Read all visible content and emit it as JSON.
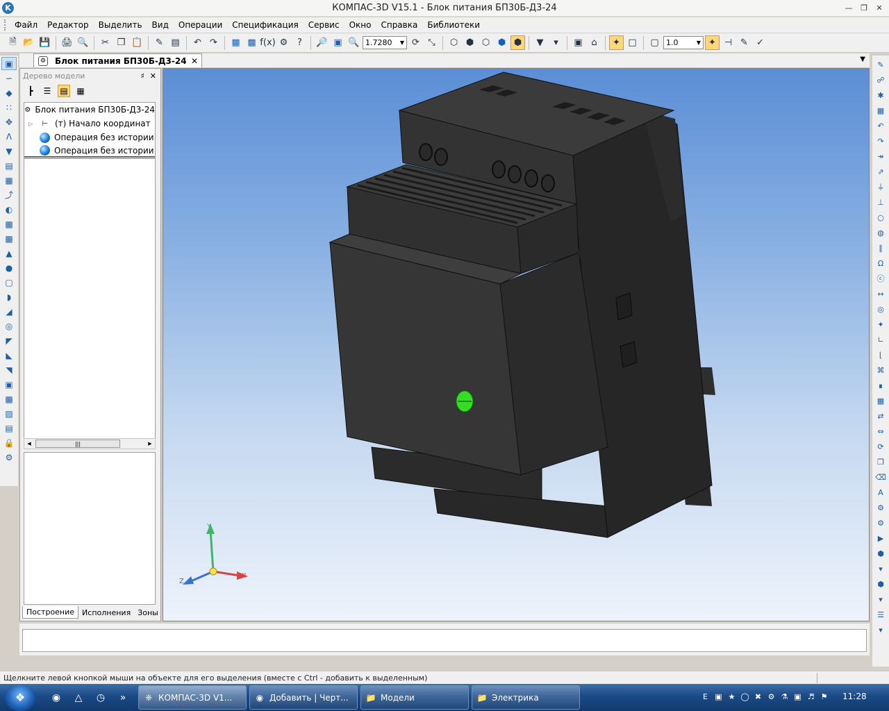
{
  "window": {
    "title": "КОМПАС-3D V15.1 - Блок питания БП30Б-Д3-24",
    "app_icon": "K",
    "controls": [
      "minimize-icon",
      "restore-icon",
      "close-icon"
    ]
  },
  "menu": {
    "items": [
      "Файл",
      "Редактор",
      "Выделить",
      "Вид",
      "Операции",
      "Спецификация",
      "Сервис",
      "Окно",
      "Справка",
      "Библиотеки"
    ]
  },
  "toolbar": {
    "zoom_value": "1.7280",
    "scale_value": "1.0"
  },
  "document": {
    "tab_label": "Блок питания БП30Б-Д3-24"
  },
  "tree_panel": {
    "title": "Дерево модели",
    "items": [
      {
        "label": "Блок питания БП30Б-Д3-24",
        "icon": "assembly-icon"
      },
      {
        "label": "(т) Начало координат",
        "icon": "origin-icon"
      },
      {
        "label": "Операция без истории:",
        "icon": "body-icon"
      },
      {
        "label": "Операция без истории:",
        "icon": "body-icon"
      }
    ],
    "tabs": [
      "Построение",
      "Исполнения",
      "Зоны"
    ]
  },
  "axes": {
    "x": "X",
    "y": "Y",
    "z": "Z"
  },
  "status": {
    "message": "Щелкните левой кнопкой мыши на объекте для его выделения (вместе с Ctrl - добавить к выделенным)"
  },
  "taskbar": {
    "tasks": [
      {
        "label": "КОМПАС-3D V1...",
        "icon": "kompas-icon"
      },
      {
        "label": "Добавить | Черт...",
        "icon": "chrome-icon"
      },
      {
        "label": "Модели",
        "icon": "folder-icon"
      },
      {
        "label": "Электрика",
        "icon": "folder-icon"
      }
    ],
    "clock": "11:28",
    "language": "E"
  },
  "colors": {
    "viewport_top": "#5b8ed6",
    "viewport_bottom": "#eef3fb",
    "model_body": "#3a3a3a",
    "led": "#33dd22"
  }
}
